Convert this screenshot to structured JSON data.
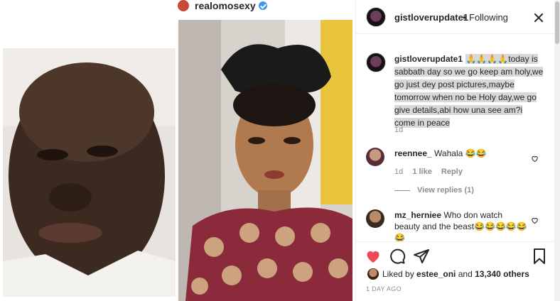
{
  "embedded_post": {
    "username": "realomosexy",
    "verified": true
  },
  "header": {
    "username": "gistloverupdate1",
    "separator": "•",
    "follow_status": "Following"
  },
  "caption": {
    "username": "gistloverupdate1",
    "text": "🙏🙏🙏🙏today is sabbath day so we go keep am holy,we go just dey post pictures,maybe tomorrow when no be Holy day,we go give details,abi how una see am?i come in peace",
    "time": "1d"
  },
  "comments": [
    {
      "username": "reennee_",
      "text": "Wahala 😂😂",
      "time": "1d",
      "likes": "1 like",
      "reply_label": "Reply",
      "view_replies": "View replies (1)"
    },
    {
      "username": "mz_herniee",
      "text": "Who don watch beauty and the beast😂😂😂😂😂😂"
    }
  ],
  "actions": {
    "like_icon": "heart-filled-icon",
    "comment_icon": "comment-icon",
    "share_icon": "share-icon",
    "save_icon": "bookmark-icon",
    "like_color": "#ed4956"
  },
  "likes": {
    "prefix": "Liked by ",
    "user": "estee_oni",
    "middle": " and ",
    "count": "13,340 others"
  },
  "timestamp": "1 DAY AGO"
}
